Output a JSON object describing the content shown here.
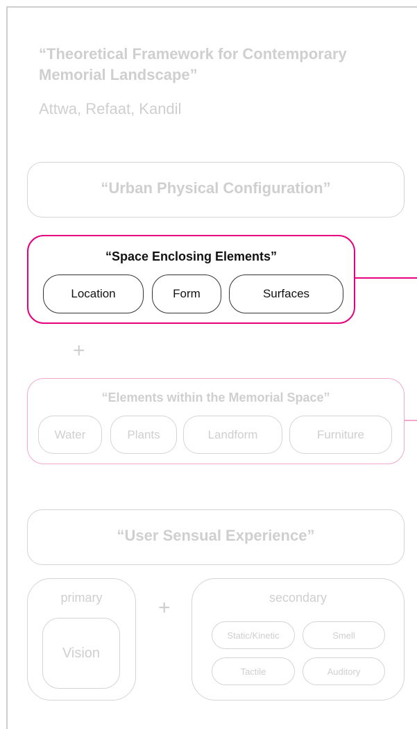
{
  "header": {
    "title": "“Theoretical Framework for Contemporary Memorial Landscape”",
    "authors": "Attwa, Refaat, Kandil"
  },
  "urban_configuration": {
    "heading": "“Urban Physical Configuration”"
  },
  "space_enclosing": {
    "heading": "“Space Enclosing Elements”",
    "items": [
      "Location",
      "Form",
      "Surfaces"
    ]
  },
  "join_plus": "+",
  "elements_within": {
    "heading": "“Elements within the Memorial Space”",
    "items": [
      "Water",
      "Plants",
      "Landform",
      "Furniture"
    ]
  },
  "user_experience": {
    "heading": "“User Sensual Experience”"
  },
  "primary": {
    "label": "primary",
    "item": "Vision"
  },
  "sense_plus": "+",
  "secondary": {
    "label": "secondary",
    "items": [
      "Static/Kinetic",
      "Smell",
      "Tactile",
      "Auditory"
    ]
  },
  "colors": {
    "accent": "#e6007e",
    "accent_faded": "#f4a7cd",
    "muted": "#cfcfcf",
    "active_text": "#111111"
  }
}
